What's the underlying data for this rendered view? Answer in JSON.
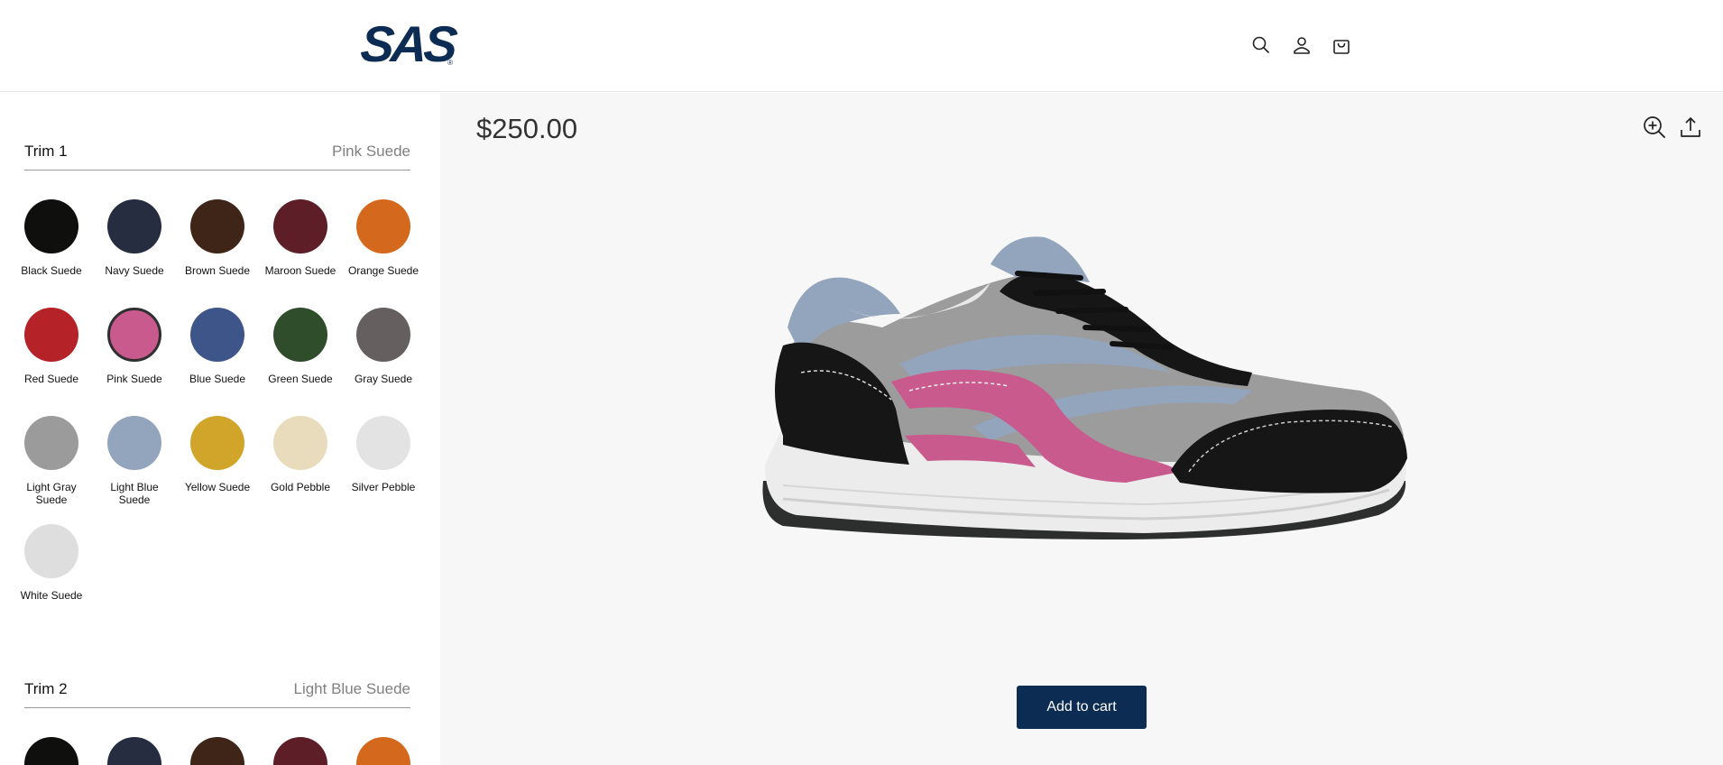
{
  "brand": {
    "logo_text": "SAS",
    "reg_mark": "®"
  },
  "header": {
    "icons": [
      "search-icon",
      "account-icon",
      "cart-icon"
    ]
  },
  "product": {
    "price": "$250.00",
    "add_to_cart_label": "Add to cart"
  },
  "trims": [
    {
      "title": "Trim 1",
      "selected": "Pink Suede",
      "swatches": [
        {
          "label": "Black Suede",
          "color": "#0f0f0d"
        },
        {
          "label": "Navy Suede",
          "color": "#262d40"
        },
        {
          "label": "Brown Suede",
          "color": "#3f2418"
        },
        {
          "label": "Maroon Suede",
          "color": "#5e1e28"
        },
        {
          "label": "Orange Suede",
          "color": "#d4691d"
        },
        {
          "label": "Red Suede",
          "color": "#b52227"
        },
        {
          "label": "Pink Suede",
          "color": "#c95a8e"
        },
        {
          "label": "Blue Suede",
          "color": "#3d5588"
        },
        {
          "label": "Green Suede",
          "color": "#2f4d2b"
        },
        {
          "label": "Gray Suede",
          "color": "#65605f"
        },
        {
          "label": "Light Gray Suede",
          "color": "#9c9b9c"
        },
        {
          "label": "Light Blue Suede",
          "color": "#93a4bd"
        },
        {
          "label": "Yellow Suede",
          "color": "#d1a52a"
        },
        {
          "label": "Gold Pebble",
          "color": "#e9dcbc"
        },
        {
          "label": "Silver Pebble",
          "color": "#e3e3e3"
        },
        {
          "label": "White Suede",
          "color": "#dedede"
        }
      ]
    },
    {
      "title": "Trim 2",
      "selected": "Light Blue Suede",
      "swatches": [
        {
          "color": "#0f0f0d"
        },
        {
          "color": "#262d40"
        },
        {
          "color": "#3f2418"
        },
        {
          "color": "#5e1e28"
        },
        {
          "color": "#d4691d"
        }
      ]
    }
  ],
  "toolbar": {
    "icons": [
      "zoom-in-icon",
      "share-icon"
    ]
  }
}
